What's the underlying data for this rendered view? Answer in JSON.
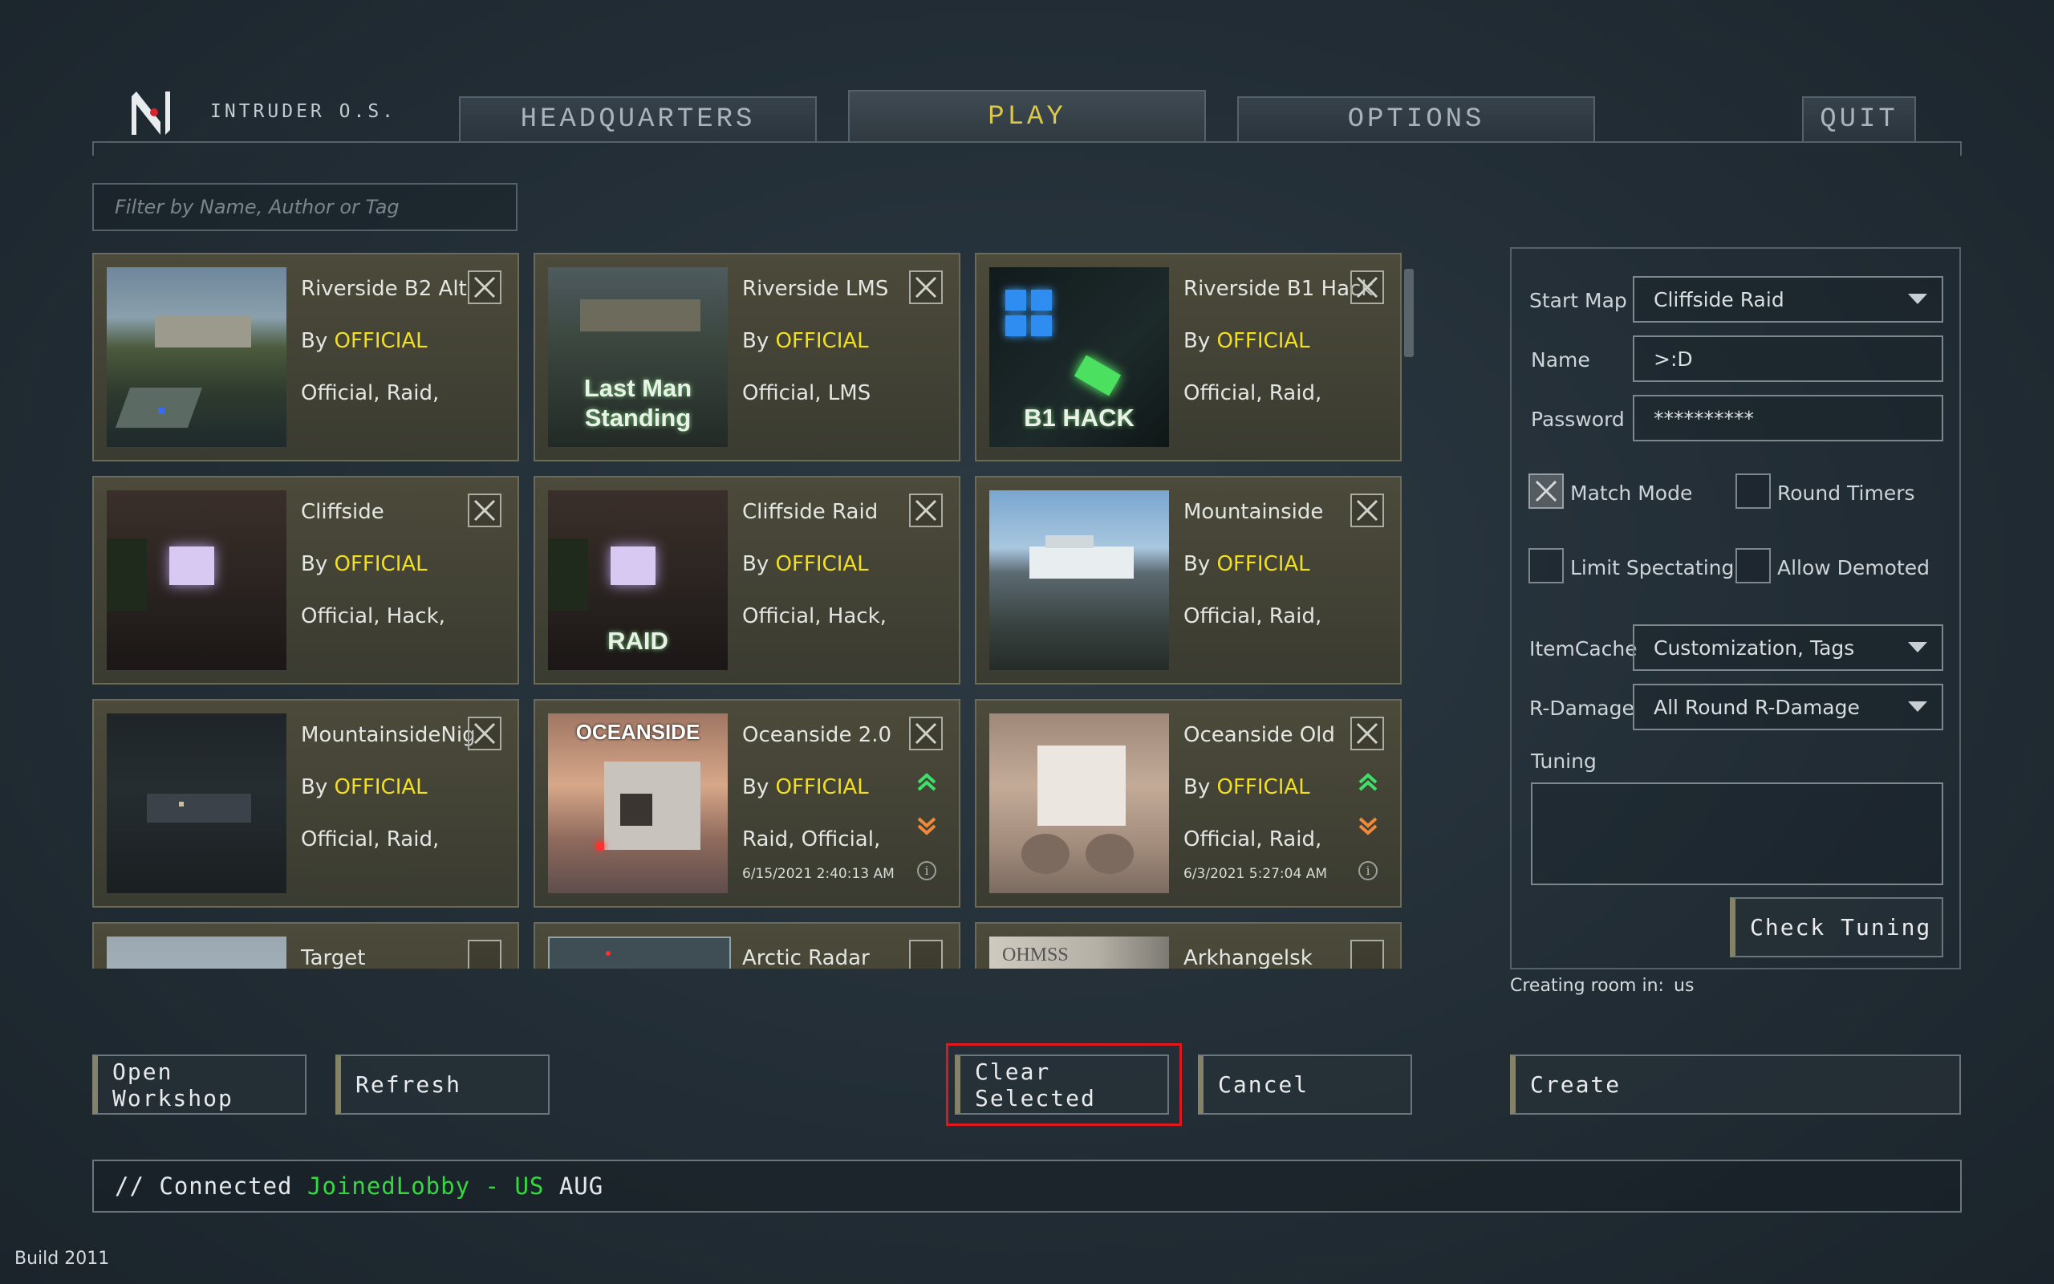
{
  "header": {
    "brand": "INTRUDER O.S.",
    "tabs": [
      {
        "label": "HEADQUARTERS",
        "active": false
      },
      {
        "label": "PLAY",
        "active": true
      },
      {
        "label": "OPTIONS",
        "active": false
      }
    ],
    "quit_label": "QUIT"
  },
  "filter": {
    "placeholder": "Filter by Name, Author or Tag",
    "value": ""
  },
  "maps": [
    {
      "name": "Riverside B2 Alt",
      "author_prefix": "By",
      "author": "OFFICIAL",
      "tags": "Official, Raid,",
      "caption": "",
      "date": ""
    },
    {
      "name": "Riverside LMS",
      "author_prefix": "By",
      "author": "OFFICIAL",
      "tags": "Official, LMS",
      "caption": "Last Man Standing",
      "date": ""
    },
    {
      "name": "Riverside B1 Hack",
      "author_prefix": "By",
      "author": "OFFICIAL",
      "tags": "Official, Raid,",
      "caption": "B1 HACK",
      "date": ""
    },
    {
      "name": "Cliffside",
      "author_prefix": "By",
      "author": "OFFICIAL",
      "tags": "Official, Hack,",
      "caption": "",
      "date": ""
    },
    {
      "name": "Cliffside Raid",
      "author_prefix": "By",
      "author": "OFFICIAL",
      "tags": "Official, Hack,",
      "caption": "RAID",
      "date": ""
    },
    {
      "name": "Mountainside",
      "author_prefix": "By",
      "author": "OFFICIAL",
      "tags": "Official, Raid,",
      "caption": "",
      "date": ""
    },
    {
      "name": "MountainsideNig",
      "author_prefix": "By",
      "author": "OFFICIAL",
      "tags": "Official, Raid,",
      "caption": "",
      "date": ""
    },
    {
      "name": "Oceanside 2.0",
      "author_prefix": "By",
      "author": "OFFICIAL",
      "tags": "Raid, Official,",
      "caption": "OCEANSIDE",
      "date": "6/15/2021 2:40:13 AM"
    },
    {
      "name": "Oceanside Old",
      "author_prefix": "By",
      "author": "OFFICIAL",
      "tags": "Official, Raid,",
      "caption": "",
      "date": "6/3/2021 5:27:04 AM"
    },
    {
      "name": "Target",
      "author_prefix": "",
      "author": "",
      "tags": "",
      "caption": "",
      "date": ""
    },
    {
      "name": "Arctic Radar",
      "author_prefix": "",
      "author": "",
      "tags": "",
      "caption": "",
      "date": ""
    },
    {
      "name": "Arkhangelsk",
      "author_prefix": "",
      "author": "",
      "tags": "",
      "caption": "OHMSS",
      "date": ""
    }
  ],
  "settings": {
    "start_map_label": "Start Map",
    "start_map_value": "Cliffside Raid",
    "name_label": "Name",
    "name_value": ">:D",
    "password_label": "Password",
    "password_value": "**********",
    "match_mode": {
      "label": "Match Mode",
      "checked": true
    },
    "round_timers": {
      "label": "Round Timers",
      "checked": false
    },
    "limit_spectating": {
      "label": "Limit Spectating",
      "checked": false
    },
    "allow_demoted": {
      "label": "Allow Demoted",
      "checked": false
    },
    "itemcache_label": "ItemCache",
    "itemcache_value": "Customization, Tags",
    "rdamage_label": "R-Damage",
    "rdamage_value": "All Round R-Damage",
    "tuning_label": "Tuning",
    "tuning_value": "",
    "check_tuning_label": "Check Tuning"
  },
  "room": {
    "label": "Creating room in:",
    "value": "us"
  },
  "buttons": {
    "open_workshop": "Open Workshop",
    "refresh": "Refresh",
    "clear_selected": "Clear Selected",
    "cancel": "Cancel",
    "create": "Create"
  },
  "status": {
    "prefix": "// Connected ",
    "state": "JoinedLobby",
    "separator": " - ",
    "region": "US",
    "suffix": " AUG"
  },
  "build": "Build 2011",
  "colors": {
    "accent_yellow": "#d9c84a",
    "author_yellow": "#f1df23",
    "status_green": "#34d93f",
    "highlight_red": "#e0181e"
  }
}
